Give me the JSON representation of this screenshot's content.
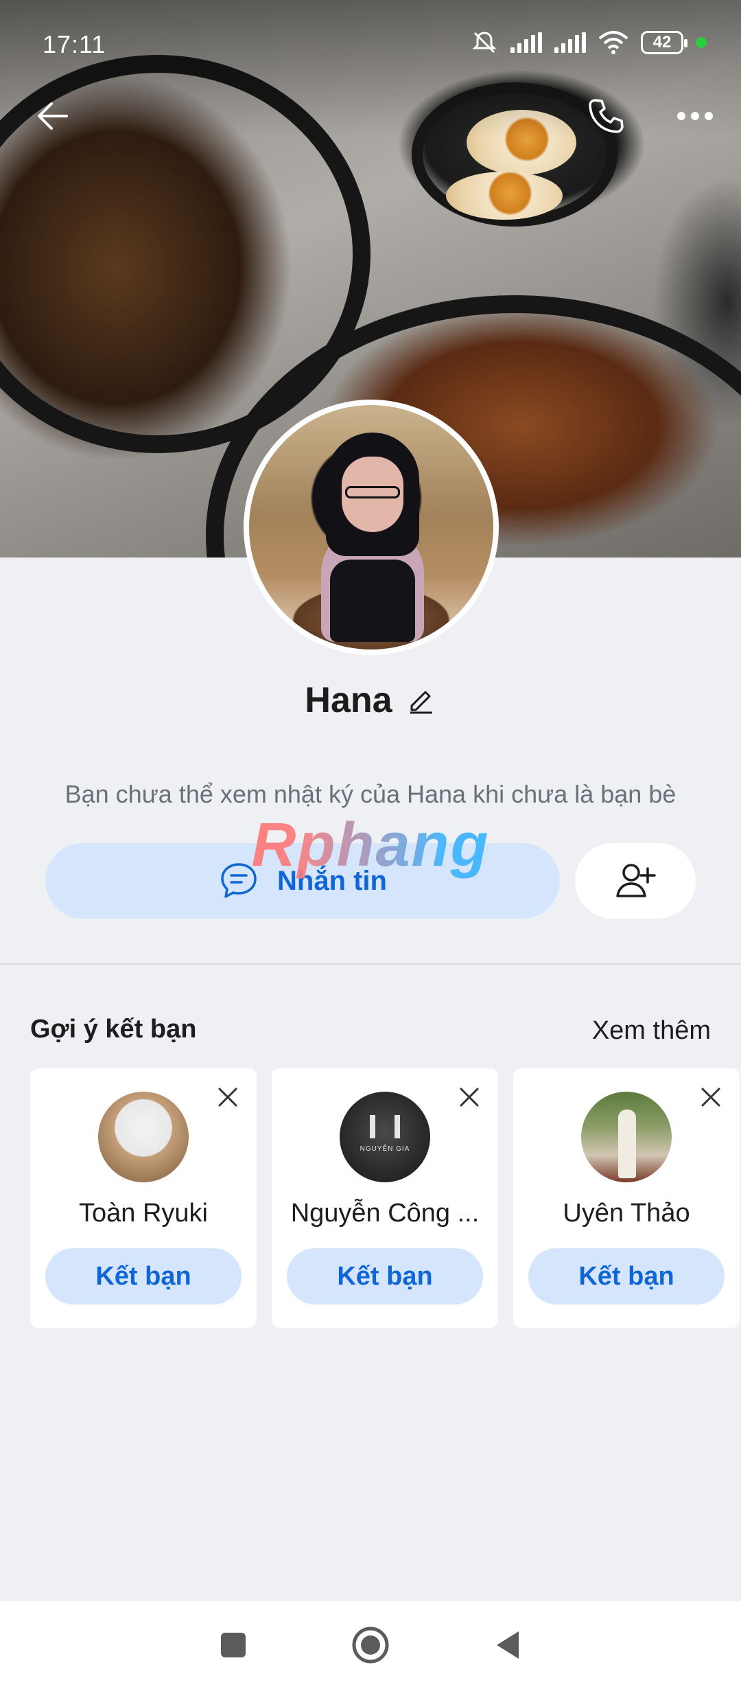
{
  "status_bar": {
    "time": "17:11",
    "battery": "42",
    "icons": [
      "mute-icon",
      "signal-icon",
      "signal-icon",
      "wifi-icon",
      "battery-icon"
    ]
  },
  "header": {
    "back_icon": "arrow-left-icon",
    "call_icon": "phone-icon",
    "more_icon": "more-horizontal-icon"
  },
  "profile": {
    "name": "Hana",
    "edit_icon": "pencil-icon",
    "privacy_notice": "Bạn chưa thể xem nhật ký của Hana khi chưa là bạn bè"
  },
  "watermark": "Rphang",
  "actions": {
    "message_label": "Nhắn tin",
    "message_icon": "chat-bubble-icon",
    "add_friend_icon": "user-plus-icon"
  },
  "suggestions": {
    "title": "Gợi ý kết bạn",
    "see_more": "Xem thêm",
    "items": [
      {
        "name": "Toàn Ryuki",
        "button": "Kết bạn"
      },
      {
        "name": "Nguyễn Công ...",
        "button": "Kết bạn",
        "avatar_text": "NGUYỄN GIA"
      },
      {
        "name": "Uyên Thảo",
        "button": "Kết bạn"
      }
    ]
  },
  "colors": {
    "accent": "#1166d6",
    "accent_bg": "#d5e6fc",
    "page_bg": "#eef0f4"
  },
  "nav": {
    "recents_icon": "square-icon",
    "home_icon": "circle-icon",
    "back_icon": "triangle-back-icon"
  }
}
